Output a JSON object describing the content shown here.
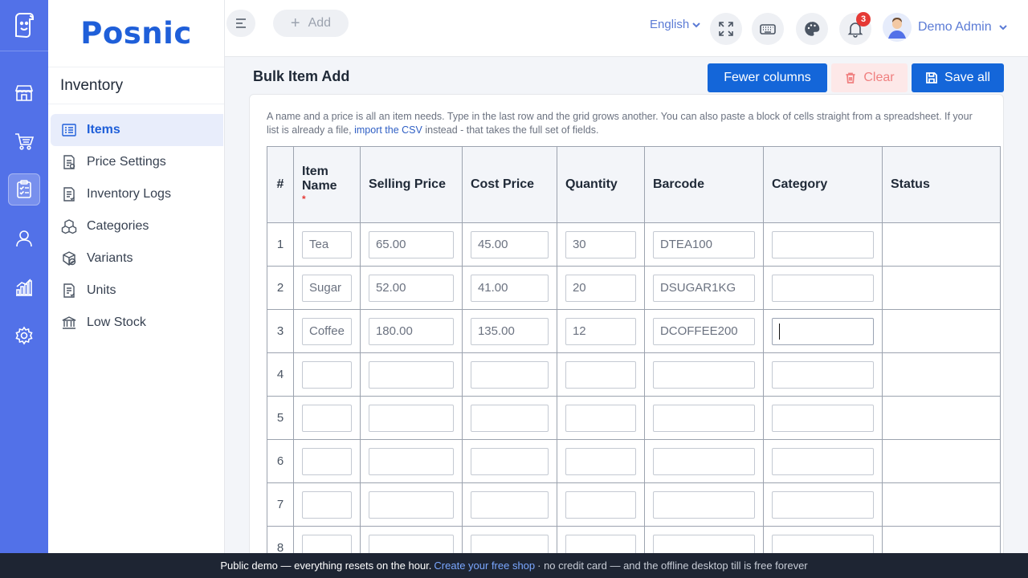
{
  "rail": {
    "items": [
      {
        "name": "store-icon"
      },
      {
        "name": "cart-icon"
      },
      {
        "name": "inventory-clipboard-icon",
        "active": true
      },
      {
        "name": "user-icon"
      },
      {
        "name": "reports-chart-icon"
      },
      {
        "name": "settings-gear-icon"
      }
    ]
  },
  "brand": "Posnic",
  "sidebar": {
    "title": "Inventory",
    "items": [
      {
        "label": "Items",
        "icon": "items-list-icon",
        "active": true
      },
      {
        "label": "Price Settings",
        "icon": "price-doc-icon"
      },
      {
        "label": "Inventory Logs",
        "icon": "logs-doc-icon"
      },
      {
        "label": "Categories",
        "icon": "categories-cubes-icon"
      },
      {
        "label": "Variants",
        "icon": "variants-cube-check-icon"
      },
      {
        "label": "Units",
        "icon": "units-doc-icon"
      },
      {
        "label": "Low Stock",
        "icon": "low-stock-bank-icon"
      }
    ]
  },
  "topbar": {
    "add_label": "Add",
    "language": "English",
    "notification_count": "3",
    "user_name": "Demo Admin"
  },
  "page": {
    "title": "Bulk Item Add",
    "fewer_columns_label": "Fewer columns",
    "clear_label": "Clear",
    "save_all_label": "Save all",
    "intro_text_1": "A name and a price is all an item needs. Type in the last row and the grid grows another. You can also paste a block of cells straight from a spreadsheet. If your list is already a file,",
    "intro_link": "import the CSV",
    "intro_text_2": "instead - that takes the full set of fields."
  },
  "grid": {
    "columns": {
      "num": "#",
      "item_name": "Item Name",
      "required_mark": "*",
      "selling_price": "Selling Price",
      "cost_price": "Cost Price",
      "quantity": "Quantity",
      "barcode": "Barcode",
      "category": "Category",
      "status": "Status"
    },
    "rows": [
      {
        "num": "1",
        "item_name": "Tea",
        "selling_price": "65.00",
        "cost_price": "45.00",
        "quantity": "30",
        "barcode": "DTEA100",
        "category": "",
        "status": ""
      },
      {
        "num": "2",
        "item_name": "Sugar",
        "selling_price": "52.00",
        "cost_price": "41.00",
        "quantity": "20",
        "barcode": "DSUGAR1KG",
        "category": "",
        "status": ""
      },
      {
        "num": "3",
        "item_name": "Coffee",
        "selling_price": "180.00",
        "cost_price": "135.00",
        "quantity": "12",
        "barcode": "DCOFFEE200",
        "category": "",
        "status": "",
        "focused": true
      },
      {
        "num": "4",
        "item_name": "",
        "selling_price": "",
        "cost_price": "",
        "quantity": "",
        "barcode": "",
        "category": "",
        "status": ""
      },
      {
        "num": "5",
        "item_name": "",
        "selling_price": "",
        "cost_price": "",
        "quantity": "",
        "barcode": "",
        "category": "",
        "status": ""
      },
      {
        "num": "6",
        "item_name": "",
        "selling_price": "",
        "cost_price": "",
        "quantity": "",
        "barcode": "",
        "category": "",
        "status": ""
      },
      {
        "num": "7",
        "item_name": "",
        "selling_price": "",
        "cost_price": "",
        "quantity": "",
        "barcode": "",
        "category": "",
        "status": ""
      },
      {
        "num": "8",
        "item_name": "",
        "selling_price": "",
        "cost_price": "",
        "quantity": "",
        "barcode": "",
        "category": "",
        "status": ""
      }
    ]
  },
  "footer": {
    "text_1": "Public demo — everything resets on the hour.",
    "link": "Create your free shop",
    "text_2": "· no credit card — and the offline desktop till is free forever"
  },
  "colors": {
    "rail": "#5271e8",
    "brand": "#1f5fd9",
    "primary_button": "#1466d9",
    "clear_button_bg": "#fde8e8",
    "badge": "#e53935",
    "footer_bg": "#1e2533"
  }
}
